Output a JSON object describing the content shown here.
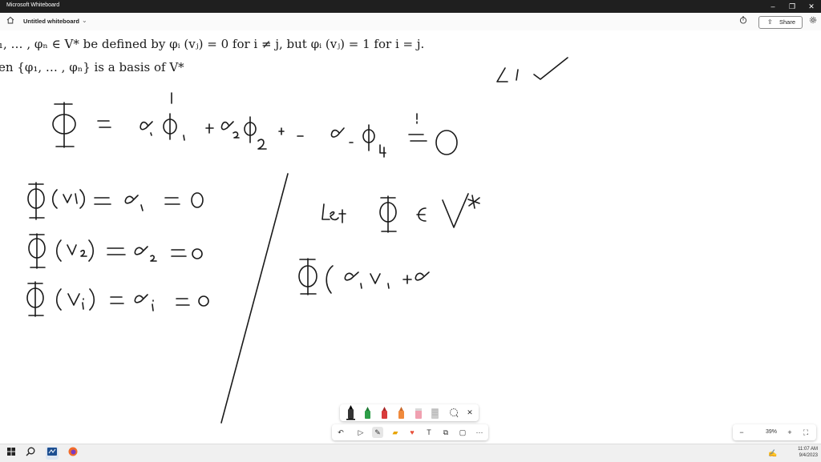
{
  "window": {
    "app_title": "Microsoft Whiteboard",
    "min": "–",
    "restore": "❐",
    "close": "✕"
  },
  "appbar": {
    "home_icon": "home-icon",
    "doc_title": "Untitled whiteboard",
    "chevron": "⌄",
    "timer_icon": "timer-icon",
    "share_label": "Share",
    "settings_icon": "gear-icon"
  },
  "board": {
    "latex_line1": "₁, … , φₙ ∈ V* be defined by φᵢ (vⱼ) = 0 for i ≠ j, but φᵢ (vⱼ) = 1 for i = j.",
    "latex_line2": "en {φ₁, … , φₙ} is a basis of V*"
  },
  "pen_tray": {
    "close": "✕"
  },
  "toolbar": {
    "more": "···"
  },
  "zoom": {
    "zoom_out": "−",
    "level": "39%",
    "zoom_in": "+"
  },
  "taskbar": {
    "time": "11:07 AM",
    "date": "9/4/2023"
  },
  "colors": {
    "titlebar": "#1f1f1f",
    "pen_black": "#000000",
    "pen_green": "#2e9e48",
    "pen_red": "#d83b3b",
    "pen_orange": "#f08a3c",
    "highlighter": "#f0a0b0"
  }
}
